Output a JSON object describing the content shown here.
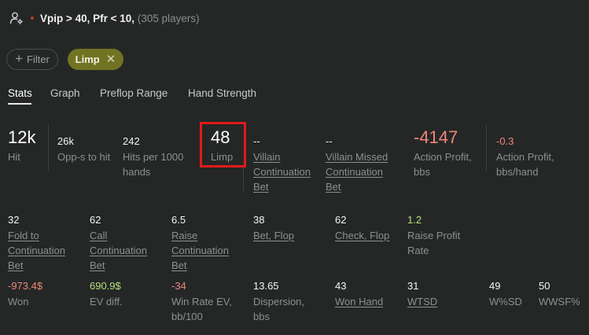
{
  "header": {
    "title": "Vpip > 40, Pfr < 10,",
    "players": "(305 players)"
  },
  "filters": {
    "add_label": "Filter",
    "active_chip": "Limp"
  },
  "tabs": [
    "Stats",
    "Graph",
    "Preflop Range",
    "Hand Strength"
  ],
  "row1": {
    "hit": {
      "value": "12k",
      "label": "Hit"
    },
    "opps": {
      "value": "26k",
      "label": "Opp-s to hit"
    },
    "hits_per_1000": {
      "value": "242",
      "label_1": "Hits per 1000",
      "label_2": "hands"
    },
    "limp": {
      "value": "48",
      "label": "Limp"
    },
    "villain_cbet": {
      "value": "--",
      "label_1": "Villain",
      "label_2": "Continuation",
      "label_3": "Bet"
    },
    "villain_missed_cbet": {
      "value": "--",
      "label_1": "Villain Missed",
      "label_2": "Continuation",
      "label_3": "Bet"
    },
    "action_profit": {
      "value": "-4147",
      "label_1": "Action Profit,",
      "label_2": "bbs"
    },
    "action_profit_hand": {
      "value": "-0.3",
      "label_1": "Action Profit,",
      "label_2": "bbs/hand"
    }
  },
  "row2": {
    "fold_to_cbet": {
      "value": "32",
      "label_1": "Fold to",
      "label_2": "Continuation",
      "label_3": "Bet"
    },
    "call_cbet": {
      "value": "62",
      "label_1": "Call",
      "label_2": "Continuation",
      "label_3": "Bet"
    },
    "raise_cbet": {
      "value": "6.5",
      "label_1": "Raise",
      "label_2": "Continuation",
      "label_3": "Bet"
    },
    "bet_flop": {
      "value": "38",
      "label": "Bet, Flop"
    },
    "check_flop": {
      "value": "62",
      "label": "Check, Flop"
    },
    "raise_profit_rate": {
      "value": "1.2",
      "label_1": "Raise Profit",
      "label_2": "Rate"
    }
  },
  "row3": {
    "won": {
      "value": "-973.4$",
      "label": "Won"
    },
    "ev_diff": {
      "value": "690.9$",
      "label": "EV diff."
    },
    "win_rate_ev": {
      "value": "-34",
      "label_1": "Win Rate EV,",
      "label_2": "bb/100"
    },
    "dispersion": {
      "value": "13.65",
      "label_1": "Dispersion,",
      "label_2": "bbs"
    },
    "won_hand": {
      "value": "43",
      "label": "Won Hand"
    },
    "wtsd": {
      "value": "31",
      "label": "WTSD"
    },
    "wsd": {
      "value": "49",
      "label": "W%SD"
    },
    "wwsf": {
      "value": "50",
      "label": "WWSF%"
    }
  },
  "colors": {
    "background": "#242726",
    "chip_active": "#717322",
    "negative": "#f0877b",
    "positive": "#b5e07a",
    "highlight": "#e01a1a"
  }
}
